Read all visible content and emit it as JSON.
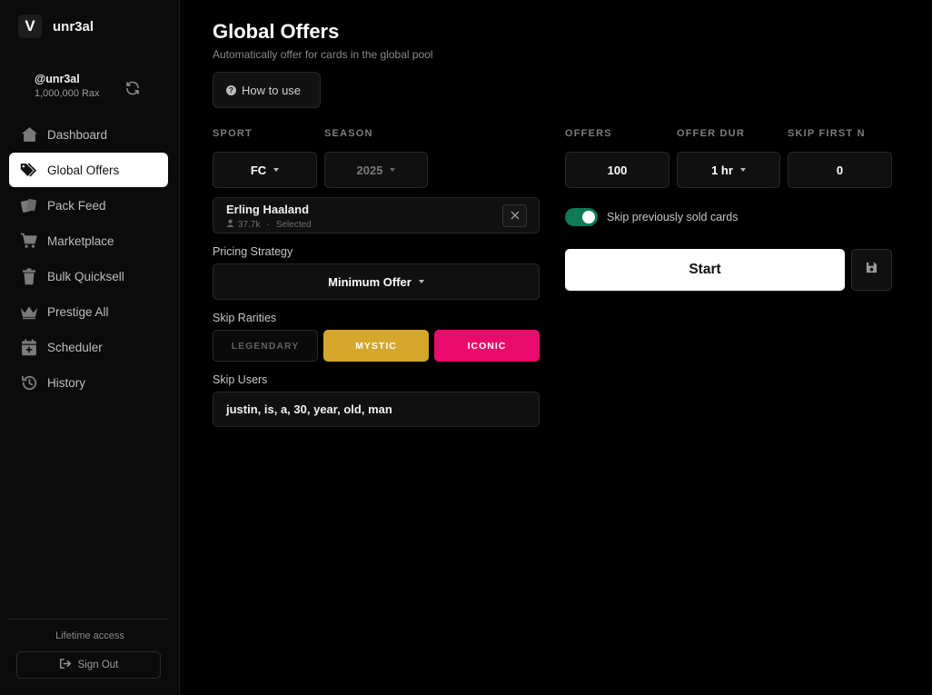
{
  "brand": {
    "logo_glyph": "V",
    "name": "unr3al"
  },
  "user": {
    "handle": "@unr3al",
    "balance": "1,000,000 Rax"
  },
  "nav": {
    "items": [
      {
        "label": "Dashboard",
        "icon": "home-icon",
        "active": false
      },
      {
        "label": "Global Offers",
        "icon": "tags-icon",
        "active": true
      },
      {
        "label": "Pack Feed",
        "icon": "cards-icon",
        "active": false
      },
      {
        "label": "Marketplace",
        "icon": "cart-icon",
        "active": false
      },
      {
        "label": "Bulk Quicksell",
        "icon": "trash-icon",
        "active": false
      },
      {
        "label": "Prestige All",
        "icon": "crown-icon",
        "active": false
      },
      {
        "label": "Scheduler",
        "icon": "calendar-plus-icon",
        "active": false
      },
      {
        "label": "History",
        "icon": "history-icon",
        "active": false
      }
    ]
  },
  "footer": {
    "access_text": "Lifetime access",
    "signout_label": "Sign Out"
  },
  "page": {
    "title": "Global Offers",
    "subtitle": "Automatically offer for cards in the global pool",
    "howto_label": "How to use"
  },
  "form": {
    "sport_label": "SPORT",
    "sport_value": "FC",
    "season_label": "SEASON",
    "season_value": "2025",
    "offers_label": "OFFERS",
    "offers_value": "100",
    "offer_dur_label": "OFFER DUR",
    "offer_dur_value": "1 hr",
    "skip_first_label": "SKIP FIRST N",
    "skip_first_value": "0",
    "player": {
      "name": "Erling Haaland",
      "count": "37.7k",
      "status": "Selected",
      "separator": "·"
    },
    "pricing_label": "Pricing Strategy",
    "pricing_value": "Minimum Offer",
    "skip_rarities_label": "Skip Rarities",
    "rarities": [
      {
        "label": "LEGENDARY",
        "selected": false
      },
      {
        "label": "MYSTIC",
        "selected": true,
        "color": "#d4a62a"
      },
      {
        "label": "ICONIC",
        "selected": true,
        "color": "#ea0a6c"
      }
    ],
    "skip_users_label": "Skip Users",
    "skip_users_value": "justin, is, a, 30, year, old, man",
    "skip_sold_label": "Skip previously sold cards",
    "skip_sold_enabled": true,
    "start_label": "Start"
  },
  "colors": {
    "accent_toggle": "#0f7a55",
    "mystic": "#d4a62a",
    "iconic": "#ea0a6c"
  }
}
